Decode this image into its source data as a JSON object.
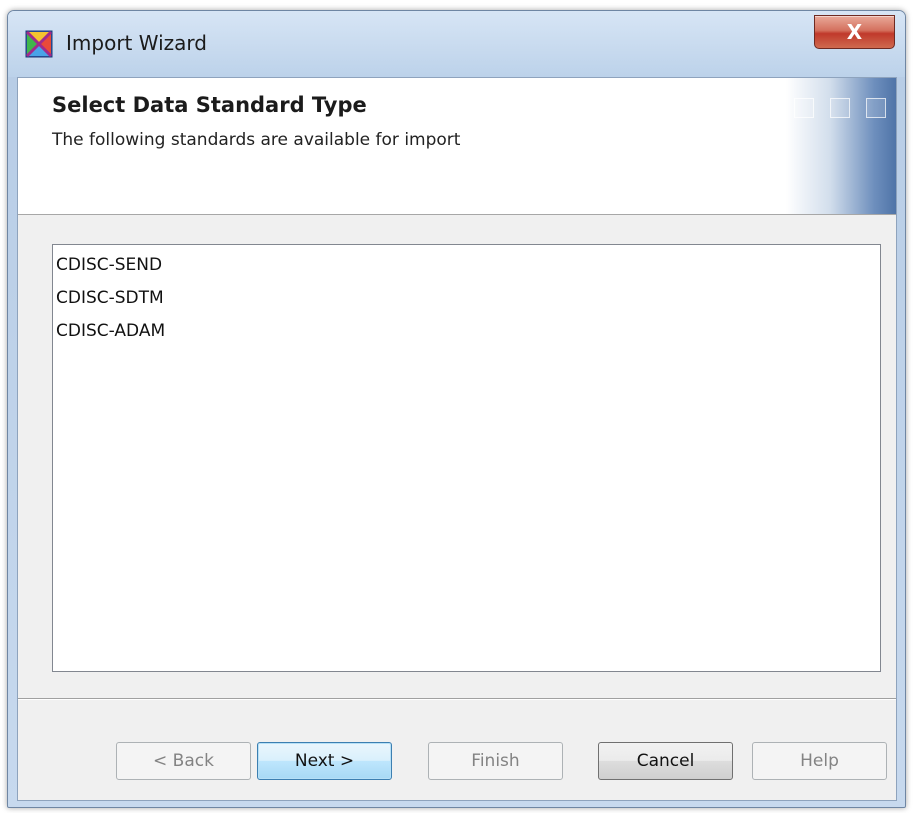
{
  "window": {
    "title": "Import Wizard",
    "close_label": "X"
  },
  "header": {
    "title": "Select Data Standard Type",
    "subtitle": "The following standards are available for import"
  },
  "standards": [
    {
      "label": "CDISC-SEND"
    },
    {
      "label": "CDISC-SDTM"
    },
    {
      "label": "CDISC-ADAM"
    }
  ],
  "buttons": {
    "back": "< Back",
    "next": "Next >",
    "finish": "Finish",
    "cancel": "Cancel",
    "help": "Help"
  },
  "colors": {
    "accent": "#3c7fb1",
    "close_red": "#c0392b"
  },
  "icons": {
    "app": "import-wizard-icon"
  }
}
